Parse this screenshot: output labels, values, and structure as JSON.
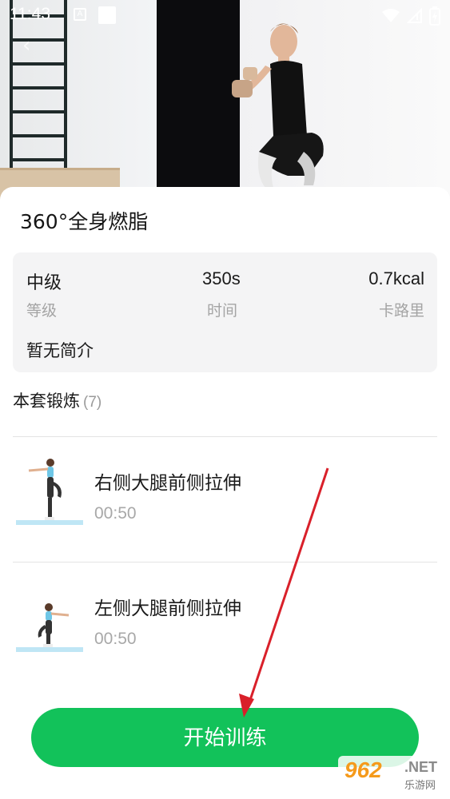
{
  "status_bar": {
    "time": "11:43",
    "a_icon_text": "A"
  },
  "workout": {
    "title": "360°全身燃脂",
    "stats": [
      {
        "value": "中级",
        "label": "等级"
      },
      {
        "value": "350s",
        "label": "时间"
      },
      {
        "value": "0.7kcal",
        "label": "卡路里"
      }
    ],
    "intro": "暂无简介"
  },
  "exercise_section": {
    "title": "本套锻炼",
    "count": "(7)"
  },
  "exercises": [
    {
      "name": "右侧大腿前侧拉伸",
      "duration": "00:50"
    },
    {
      "name": "左侧大腿前侧拉伸",
      "duration": "00:50"
    }
  ],
  "start_button": {
    "label": "开始训练"
  },
  "watermark": {
    "brand": "962",
    "suffix": ".NET",
    "subtitle": "乐游网"
  },
  "colors": {
    "accent": "#12c25a",
    "annotation_arrow": "#d9202a"
  }
}
